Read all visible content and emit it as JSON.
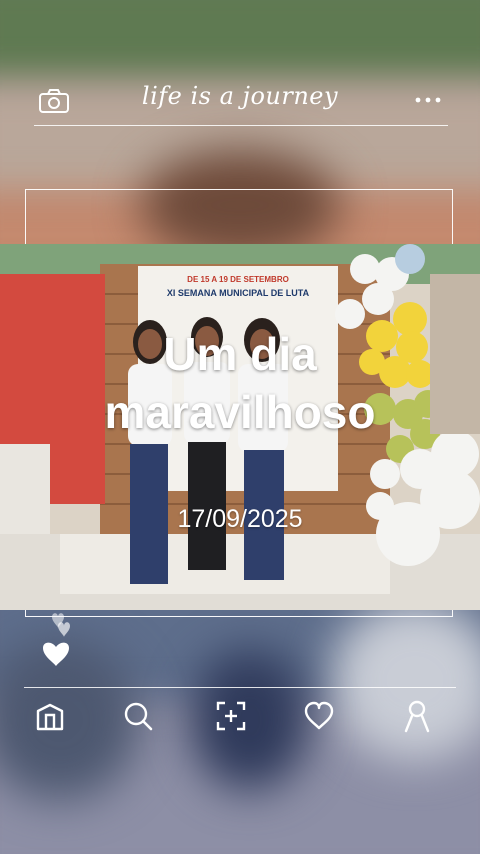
{
  "header": {
    "title": "life is a journey",
    "camera_icon": "camera-icon",
    "more_icon": "more-icon"
  },
  "photo": {
    "description_icon": "photo",
    "banner_text_line1": "DE 15 A 19 DE SETEMBRO",
    "banner_text_line2": "XI SEMANA MUNICIPAL DE LUTA"
  },
  "overlay": {
    "title": "Um dia maravilhoso",
    "date": "17/09/2025"
  },
  "actions": {
    "like_icon": "heart-icon"
  },
  "nav": {
    "items": [
      "home-icon",
      "search-icon",
      "add-icon",
      "heart-icon",
      "profile-icon"
    ]
  },
  "colors": {
    "text": "#ffffff",
    "divider": "#ffffff",
    "balloon_yellow": "#f2d33b",
    "balloon_green": "#b7c25a",
    "balloon_white": "#f4f4f2"
  }
}
